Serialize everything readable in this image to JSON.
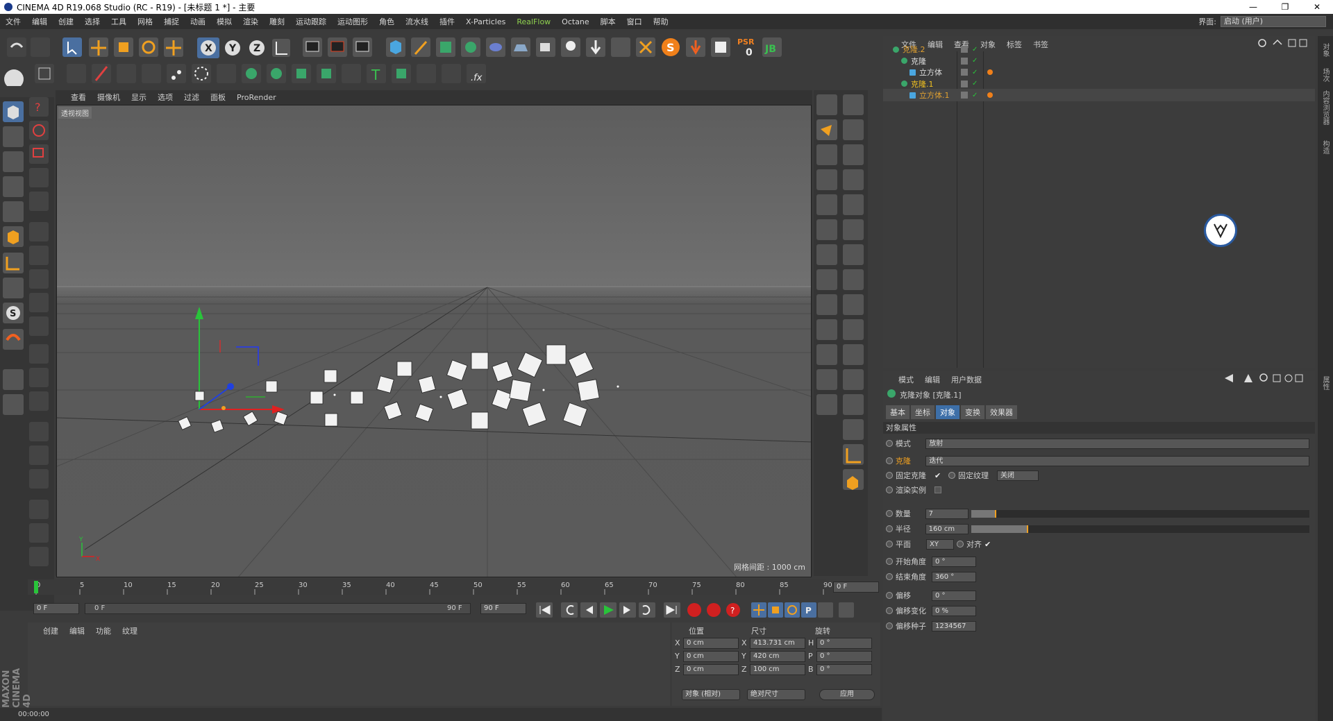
{
  "title": "CINEMA 4D R19.068 Studio (RC - R19) - [未标题 1 *] - 主要",
  "window_buttons": [
    "—",
    "❐",
    "✕"
  ],
  "menu": [
    "文件",
    "编辑",
    "创建",
    "选择",
    "工具",
    "网格",
    "捕捉",
    "动画",
    "模拟",
    "渲染",
    "雕刻",
    "运动跟踪",
    "运动图形",
    "角色",
    "流水线",
    "插件",
    "X-Particles",
    "RealFlow",
    "Octane",
    "脚本",
    "窗口",
    "帮助"
  ],
  "menu_highlight": "RealFlow",
  "layout": {
    "label": "界面:",
    "value": "启动 (用户)"
  },
  "viewport": {
    "menu": [
      "查看",
      "摄像机",
      "显示",
      "选项",
      "过滤",
      "面板",
      "ProRender"
    ],
    "label": "透视视图",
    "grid_info": "网格间距 : 1000 cm",
    "axis_labels": {
      "y": "Y",
      "x": "X"
    }
  },
  "timeline": {
    "ticks": [
      "0",
      "5",
      "10",
      "15",
      "20",
      "25",
      "30",
      "35",
      "40",
      "45",
      "50",
      "55",
      "60",
      "65",
      "70",
      "75",
      "80",
      "85",
      "90"
    ],
    "end": "0 F"
  },
  "playbar": {
    "start": "0 F",
    "range_start": "0 F",
    "range_end": "90 F",
    "end": "90 F"
  },
  "material_menu": [
    "创建",
    "编辑",
    "功能",
    "纹理"
  ],
  "coords": {
    "headers": [
      "位置",
      "尺寸",
      "旋转"
    ],
    "rows": [
      {
        "axis": "X",
        "pos": "0 cm",
        "size_axis": "X",
        "size": "413.731 cm",
        "rot_axis": "H",
        "rot": "0 °"
      },
      {
        "axis": "Y",
        "pos": "0 cm",
        "size_axis": "Y",
        "size": "420 cm",
        "rot_axis": "P",
        "rot": "0 °"
      },
      {
        "axis": "Z",
        "pos": "0 cm",
        "size_axis": "Z",
        "size": "100 cm",
        "rot_axis": "B",
        "rot": "0 °"
      }
    ],
    "mode1": "对象 (相对)",
    "mode2": "绝对尺寸",
    "apply": "应用"
  },
  "status": "00:00:00",
  "maxon": "MAXON CINEMA 4D",
  "objects": {
    "menu": [
      "文件",
      "编辑",
      "查看",
      "对象",
      "标签",
      "书签"
    ],
    "rows": [
      {
        "name": "克隆.2",
        "indent": 0,
        "color": "#e0a030"
      },
      {
        "name": "克隆",
        "indent": 1,
        "color": "#dddddd"
      },
      {
        "name": "立方体",
        "indent": 2,
        "color": "#dddddd"
      },
      {
        "name": "克隆.1",
        "indent": 1,
        "color": "#f0c020"
      },
      {
        "name": "立方体.1",
        "indent": 2,
        "color": "#e0a030"
      }
    ]
  },
  "attributes": {
    "menu": [
      "模式",
      "编辑",
      "用户数据"
    ],
    "header": "克隆对象 [克隆.1]",
    "tabs": [
      "基本",
      "坐标",
      "对象",
      "变换",
      "效果器"
    ],
    "active_tab": "对象",
    "section": "对象属性",
    "mode_label": "模式",
    "mode_value": "放射",
    "clone_label": "克隆",
    "clone_value": "迭代",
    "fix_clone": "固定克隆",
    "fix_texture": "固定纹理",
    "fix_texture_value": "关闭",
    "render_instance": "渲染实例",
    "count_label": "数量",
    "count_value": "7",
    "radius_label": "半径",
    "radius_value": "160 cm",
    "plane_label": "平面",
    "plane_value": "XY",
    "align_label": "对齐",
    "start_angle_label": "开始角度",
    "start_angle_value": "0 °",
    "end_angle_label": "结束角度",
    "end_angle_value": "360 °",
    "offset_label": "偏移",
    "offset_value": "0 °",
    "offset_var_label": "偏移变化",
    "offset_var_value": "0 %",
    "offset_seed_label": "偏移种子",
    "offset_seed_value": "1234567"
  },
  "side_tabs": [
    "对象",
    "场次",
    "内容浏览器",
    "构造",
    "属性"
  ],
  "colors": {
    "accent": "#3d6fa8",
    "highlight": "#8fd14f",
    "orange": "#f0a020"
  }
}
